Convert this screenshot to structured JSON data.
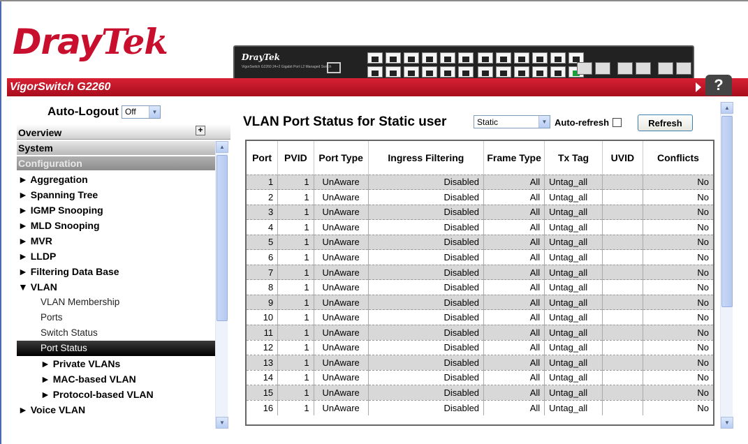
{
  "brand": {
    "logo_dray": "Dray",
    "logo_tek": "Tek",
    "model": "VigorSwitch G2260",
    "device_logo": "DrayTek",
    "device_subtitle": "VigorSwitch G2260 24+2 Gigabit Port L2 Managed Switch",
    "help_label": "?"
  },
  "sidebar": {
    "autologout_label": "Auto-Logout",
    "autologout_value": "Off",
    "overview_label": "Overview",
    "system_label": "System",
    "configuration_label": "Configuration",
    "items": [
      {
        "label": "► Aggregation",
        "level": 1
      },
      {
        "label": "► Spanning Tree",
        "level": 1
      },
      {
        "label": "► IGMP Snooping",
        "level": 1
      },
      {
        "label": "► MLD Snooping",
        "level": 1
      },
      {
        "label": "► MVR",
        "level": 1
      },
      {
        "label": "► LLDP",
        "level": 1
      },
      {
        "label": "► Filtering Data Base",
        "level": 1
      },
      {
        "label": "▼ VLAN",
        "level": 1
      },
      {
        "label": "VLAN Membership",
        "level": 2
      },
      {
        "label": "Ports",
        "level": 2
      },
      {
        "label": "Switch Status",
        "level": 2
      },
      {
        "label": "Port Status",
        "level": 2,
        "selected": true
      },
      {
        "label": "► Private VLANs",
        "level": 3
      },
      {
        "label": "► MAC-based VLAN",
        "level": 3
      },
      {
        "label": "► Protocol-based VLAN",
        "level": 3
      },
      {
        "label": "► Voice VLAN",
        "level": 1
      }
    ]
  },
  "main": {
    "title": "VLAN Port Status for Static user",
    "user_select_value": "Static",
    "autorefresh_label": "Auto-refresh",
    "autorefresh_checked": false,
    "refresh_label": "Refresh",
    "columns": [
      "Port",
      "PVID",
      "Port Type",
      "Ingress Filtering",
      "Frame Type",
      "Tx Tag",
      "UVID",
      "Conflicts"
    ],
    "rows": [
      [
        "1",
        "1",
        "UnAware",
        "Disabled",
        "All",
        "Untag_all",
        "",
        "No"
      ],
      [
        "2",
        "1",
        "UnAware",
        "Disabled",
        "All",
        "Untag_all",
        "",
        "No"
      ],
      [
        "3",
        "1",
        "UnAware",
        "Disabled",
        "All",
        "Untag_all",
        "",
        "No"
      ],
      [
        "4",
        "1",
        "UnAware",
        "Disabled",
        "All",
        "Untag_all",
        "",
        "No"
      ],
      [
        "5",
        "1",
        "UnAware",
        "Disabled",
        "All",
        "Untag_all",
        "",
        "No"
      ],
      [
        "6",
        "1",
        "UnAware",
        "Disabled",
        "All",
        "Untag_all",
        "",
        "No"
      ],
      [
        "7",
        "1",
        "UnAware",
        "Disabled",
        "All",
        "Untag_all",
        "",
        "No"
      ],
      [
        "8",
        "1",
        "UnAware",
        "Disabled",
        "All",
        "Untag_all",
        "",
        "No"
      ],
      [
        "9",
        "1",
        "UnAware",
        "Disabled",
        "All",
        "Untag_all",
        "",
        "No"
      ],
      [
        "10",
        "1",
        "UnAware",
        "Disabled",
        "All",
        "Untag_all",
        "",
        "No"
      ],
      [
        "11",
        "1",
        "UnAware",
        "Disabled",
        "All",
        "Untag_all",
        "",
        "No"
      ],
      [
        "12",
        "1",
        "UnAware",
        "Disabled",
        "All",
        "Untag_all",
        "",
        "No"
      ],
      [
        "13",
        "1",
        "UnAware",
        "Disabled",
        "All",
        "Untag_all",
        "",
        "No"
      ],
      [
        "14",
        "1",
        "UnAware",
        "Disabled",
        "All",
        "Untag_all",
        "",
        "No"
      ],
      [
        "15",
        "1",
        "UnAware",
        "Disabled",
        "All",
        "Untag_all",
        "",
        "No"
      ],
      [
        "16",
        "1",
        "UnAware",
        "Disabled",
        "All",
        "Untag_all",
        "",
        "No"
      ]
    ]
  },
  "colors": {
    "brand_red": "#c8102e",
    "selected_bg": "#000000",
    "row_alt": "#d8d8d8"
  }
}
